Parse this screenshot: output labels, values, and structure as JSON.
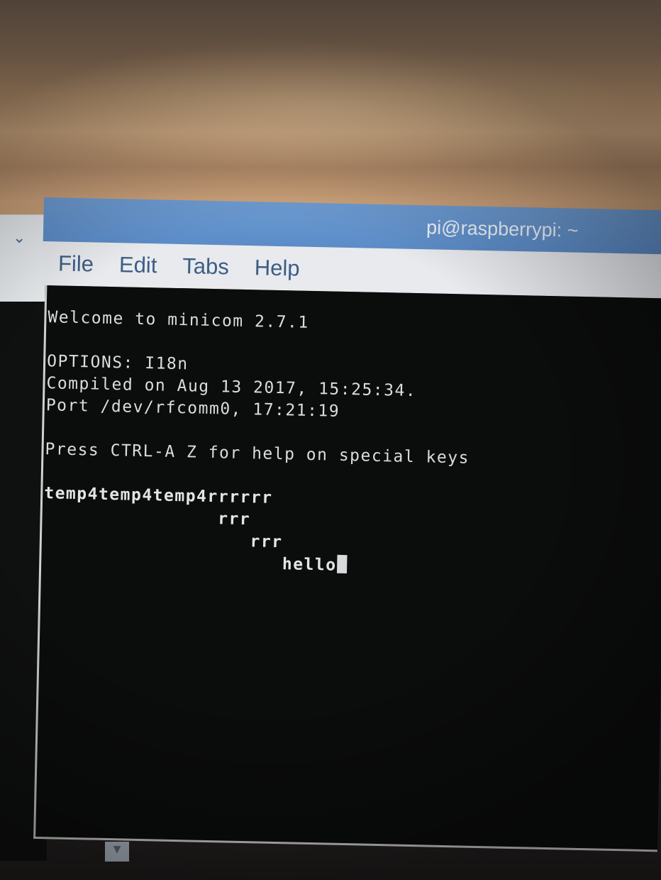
{
  "window": {
    "title": "pi@raspberrypi: ~"
  },
  "menu": {
    "file": "File",
    "edit": "Edit",
    "tabs": "Tabs",
    "help": "Help"
  },
  "side_panel": {
    "chevron_icon": "chevron-down-icon"
  },
  "terminal": {
    "lines": [
      "Welcome to minicom 2.7.1",
      "",
      "OPTIONS: I18n",
      "Compiled on Aug 13 2017, 15:25:34.",
      "Port /dev/rfcomm0, 17:21:19",
      "",
      "Press CTRL-A Z for help on special keys",
      "",
      "temp4temp4temp4rrrrrr",
      "                rrr",
      "                   rrr",
      "                      hello"
    ]
  },
  "colors": {
    "titlebar": "#5b8cc8",
    "menu_text": "#3c5d85",
    "terminal_bg": "#0b0c0c",
    "terminal_text": "#dcdcdc"
  }
}
